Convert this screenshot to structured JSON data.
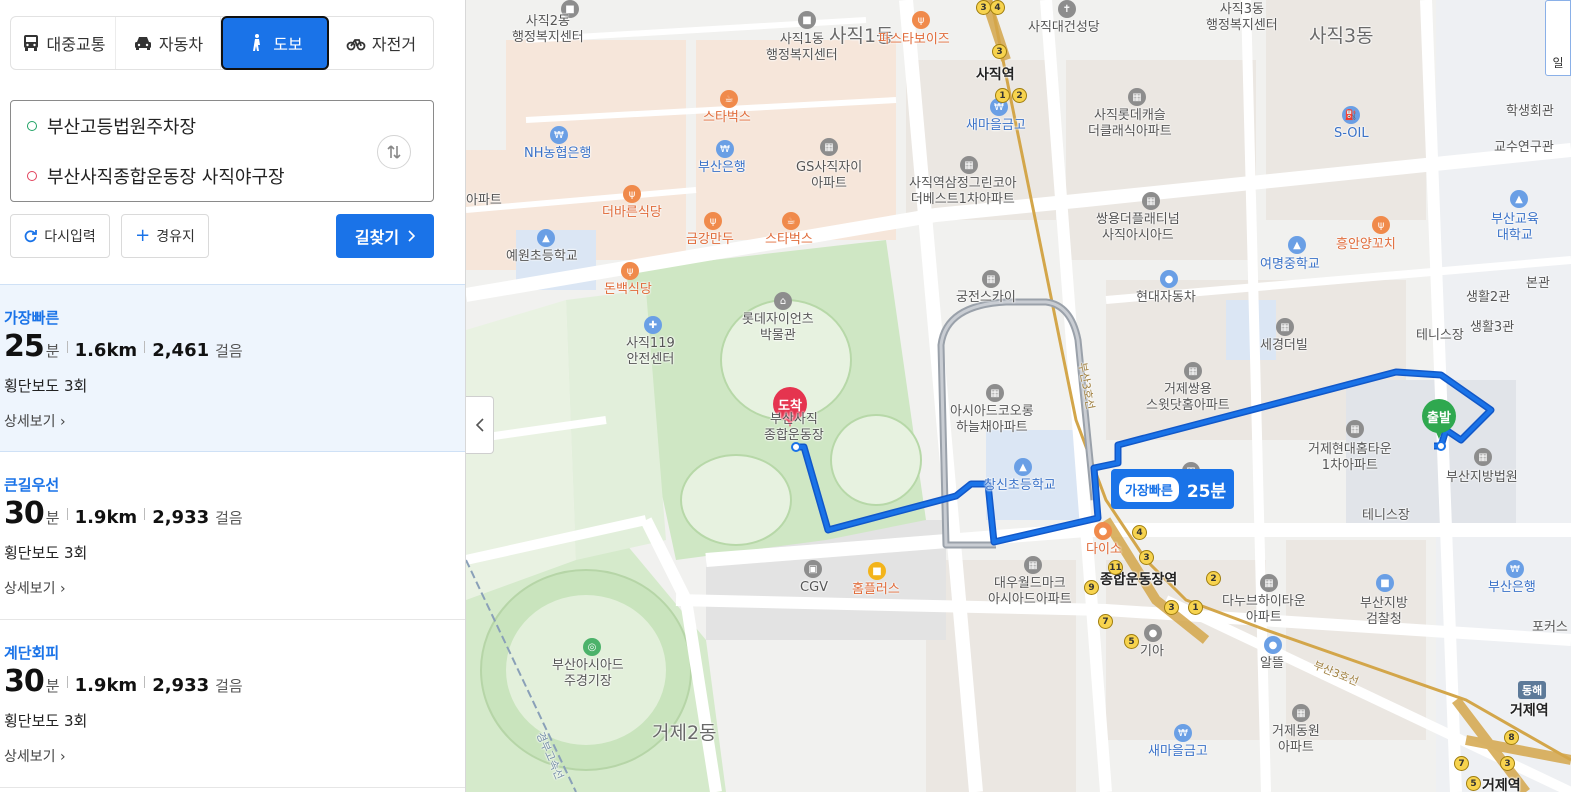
{
  "modes": [
    {
      "label": "대중교통",
      "icon": "bus-icon"
    },
    {
      "label": "자동차",
      "icon": "car-icon"
    },
    {
      "label": "도보",
      "icon": "walk-icon",
      "active": true
    },
    {
      "label": "자전거",
      "icon": "bicycle-icon"
    }
  ],
  "route": {
    "from": "부산고등법원주차장",
    "to": "부산사직종합운동장 사직야구장"
  },
  "buttons": {
    "reset": "다시입력",
    "waypoint": "경유지",
    "search": "길찾기"
  },
  "results": [
    {
      "label": "가장빠른",
      "minutes": "25",
      "min_unit": "분",
      "distance": "1.6km",
      "steps": "2,461",
      "steps_unit": "걸음",
      "crosswalk": "횡단보도 3회",
      "detail": "상세보기"
    },
    {
      "label": "큰길우선",
      "minutes": "30",
      "min_unit": "분",
      "distance": "1.9km",
      "steps": "2,933",
      "steps_unit": "걸음",
      "crosswalk": "횡단보도 3회",
      "detail": "상세보기"
    },
    {
      "label": "계단회피",
      "minutes": "30",
      "min_unit": "분",
      "distance": "1.9km",
      "steps": "2,933",
      "steps_unit": "걸음",
      "crosswalk": "횡단보도 3회",
      "detail": "상세보기"
    }
  ],
  "map": {
    "route_badge": {
      "tag": "가장빠른",
      "time": "25분"
    },
    "start_pin": "출발",
    "end_pin": "도착",
    "corner_control": "일",
    "line_badge": "동해",
    "labels": {
      "sajik1": "사직1동",
      "sajik3": "사직3동",
      "geoje2": "거제2동",
      "sajik_station": "사직역",
      "stadium_station": "종합운동장역",
      "geoje_station": "거제역",
      "geoje_station2": "거제역",
      "sajik2_center": "사직2동\n행정복지센터",
      "sajik1_center": "사직1동\n행정복지센터",
      "sajik3_center": "사직3동\n행정복지센터",
      "pasta": "파스타보이즈",
      "sajik_church": "사직대건성당",
      "starbucks1": "스타벅스",
      "starbucks2": "스타벅스",
      "nh_bank": "NH농협은행",
      "busan_bank": "부산은행",
      "busan_bank2": "부산은행",
      "gs_apt": "GS사직자이\n아파트",
      "samjeong": "사직역삼정그린코아\n더베스트1차아파트",
      "lotte_castle": "사직롯데캐슬\n더클래식아파트",
      "soil": "S-OIL",
      "saemaul1": "새마을금고",
      "saemaul2": "새마을금고",
      "ssangyong": "쌍용더플래티넘\n사직아시아드",
      "yewon": "예원초등학교",
      "deobareun": "더바른식당",
      "geumgang": "금강만두",
      "donbaek": "돈백식당",
      "apt_left": "아파트",
      "welfare": "학생회관",
      "prof": "교수연구관",
      "busan_edu": "부산교육\n대학교",
      "heungan": "흥안양꼬치",
      "yeomyeong": "여명중학교",
      "hyundai_car": "현대자동차",
      "gungjeon": "궁전스카이",
      "lotte_giants": "롯데자이언츠\n박물관",
      "safety119": "사직119\n안전센터",
      "stadium": "부산사직\n종합운동장",
      "seil": "세경더빌",
      "geoje_ssangyong": "거제쌍용\n스윗닷홈아파트",
      "asiad_coolong": "아시아드코오롱\n하늘채아파트",
      "changsin": "창신초등학교",
      "geoje_hyundai": "거제현대홈타운\n1차아파트",
      "court": "부산지방법원",
      "tennis": "테니스장",
      "tennis2": "테니스장",
      "life2": "생활2관",
      "life3": "생활3관",
      "main_bldg": "본관",
      "daiso": "다이소",
      "cgv": "CGV",
      "homeplus": "홈플러스",
      "daewoo": "대우월드마크\n아시아드아파트",
      "danubu": "다누브하이타운\n아파트",
      "prosecutor": "부산지방\n검찰청",
      "kia": "기아",
      "albam": "알뜰",
      "asiad_main": "부산아시아드\n주경기장",
      "geoje_dongwon": "거제동원\n아파트",
      "pocus": "포커스",
      "line3": "부산3호선",
      "line3b": "부산3호선",
      "expressway": "경부고속선"
    }
  }
}
